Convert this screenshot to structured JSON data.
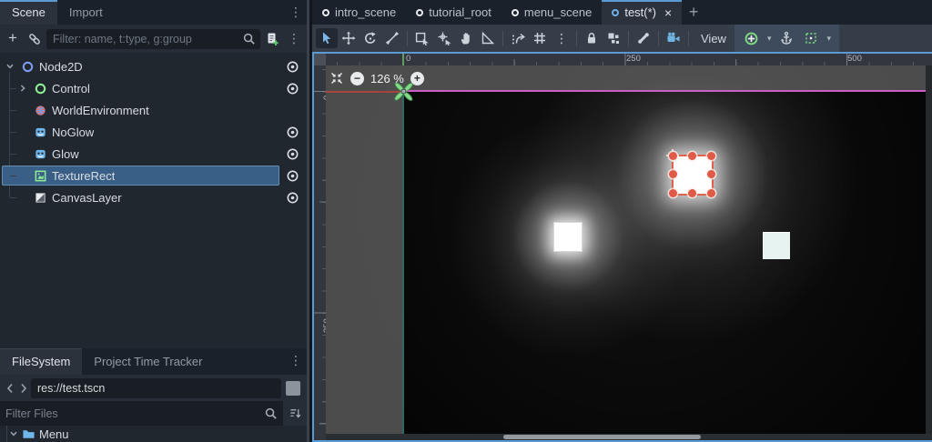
{
  "colors": {
    "accent": "#5b9bd3",
    "selection": "#3a5f87",
    "viewport_border": "#5b9bd3",
    "magenta_boundary_line": "#c75fc7",
    "red_guide_line": "#a8443c",
    "green_axis_line": "#5e9e63",
    "teal_guide_line": "#2f6868",
    "selection_handle": "#e05a47"
  },
  "left_dock": {
    "tabs": [
      {
        "label": "Scene",
        "active": true
      },
      {
        "label": "Import",
        "active": false
      }
    ],
    "filter_placeholder": "Filter: name, t:type, g:group",
    "tree": [
      {
        "name": "Node2D",
        "icon": "node2d-icon",
        "depth": 0,
        "expand": "open",
        "eye": true,
        "selected": false
      },
      {
        "name": "Control",
        "icon": "control-icon",
        "depth": 1,
        "expand": "closed",
        "eye": true,
        "selected": false
      },
      {
        "name": "WorldEnvironment",
        "icon": "world-environment-icon",
        "depth": 1,
        "expand": "none",
        "eye": false,
        "selected": false
      },
      {
        "name": "NoGlow",
        "icon": "sprite2d-icon",
        "depth": 1,
        "expand": "none",
        "eye": true,
        "selected": false
      },
      {
        "name": "Glow",
        "icon": "sprite2d-icon",
        "depth": 1,
        "expand": "none",
        "eye": true,
        "selected": false
      },
      {
        "name": "TextureRect",
        "icon": "texture-rect-icon",
        "depth": 1,
        "expand": "none",
        "eye": true,
        "selected": true
      },
      {
        "name": "CanvasLayer",
        "icon": "canvas-layer-icon",
        "depth": 1,
        "expand": "none",
        "eye": true,
        "selected": false
      }
    ]
  },
  "filesystem_dock": {
    "tabs": [
      {
        "label": "FileSystem",
        "active": true
      },
      {
        "label": "Project Time Tracker",
        "active": false
      }
    ],
    "path_value": "res://test.tscn",
    "filter_placeholder": "Filter Files",
    "files": [
      {
        "name": "Menu",
        "icon": "folder-icon",
        "expand": "open"
      }
    ]
  },
  "scene_tabs": {
    "tabs": [
      {
        "label": "intro_scene",
        "active": false
      },
      {
        "label": "tutorial_root",
        "active": false
      },
      {
        "label": "menu_scene",
        "active": false
      },
      {
        "label": "test(*)",
        "active": true,
        "close_label": "×"
      }
    ],
    "new_tab_label": "+"
  },
  "canvas_toolbar": {
    "view_label": "View",
    "items": [
      {
        "kind": "button",
        "name": "select-tool",
        "icon": "select",
        "active": true
      },
      {
        "kind": "button",
        "name": "move-tool",
        "icon": "move"
      },
      {
        "kind": "button",
        "name": "rotate-tool",
        "icon": "rotate"
      },
      {
        "kind": "button",
        "name": "scale-tool",
        "icon": "scale"
      },
      {
        "kind": "sep"
      },
      {
        "kind": "button",
        "name": "list-select-tool",
        "icon": "list-select"
      },
      {
        "kind": "button",
        "name": "pivot-tool",
        "icon": "pivot"
      },
      {
        "kind": "button",
        "name": "pan-tool",
        "icon": "pan"
      },
      {
        "kind": "button",
        "name": "ruler-tool",
        "icon": "ruler"
      },
      {
        "kind": "sep"
      },
      {
        "kind": "button",
        "name": "smart-snap-toggle",
        "icon": "magnet"
      },
      {
        "kind": "button",
        "name": "grid-snap-toggle",
        "icon": "grid"
      },
      {
        "kind": "button",
        "name": "snap-options-menu",
        "icon": "dots"
      },
      {
        "kind": "sep"
      },
      {
        "kind": "button",
        "name": "lock-button",
        "icon": "lock"
      },
      {
        "kind": "button",
        "name": "group-button",
        "icon": "group"
      },
      {
        "kind": "sep"
      },
      {
        "kind": "button",
        "name": "skeleton-options",
        "icon": "bone"
      },
      {
        "kind": "sep"
      },
      {
        "kind": "button",
        "name": "camera-override",
        "icon": "camera"
      },
      {
        "kind": "sep"
      },
      {
        "kind": "view"
      },
      {
        "kind": "snapgroup",
        "items": [
          {
            "kind": "button",
            "name": "anchor-preset-button",
            "icon": "anchor-preset"
          },
          {
            "kind": "chev"
          },
          {
            "kind": "button",
            "name": "anchor-mode-button",
            "icon": "anchor"
          },
          {
            "kind": "button",
            "name": "container-sizing-button",
            "icon": "handles"
          },
          {
            "kind": "chev"
          }
        ]
      }
    ]
  },
  "viewport": {
    "zoom_out_label": "−",
    "zoom_value": "126 %",
    "zoom_in_label": "+",
    "ruler_h_labels": [
      "0",
      "250",
      "500"
    ],
    "ruler_v_labels": [
      "0",
      "250"
    ]
  }
}
